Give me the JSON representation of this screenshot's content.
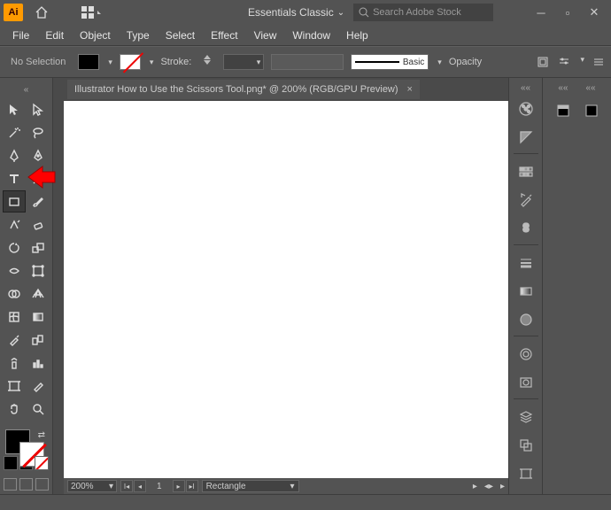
{
  "titlebar": {
    "app_abbrev": "Ai",
    "workspace_label": "Essentials Classic",
    "search_placeholder": "Search Adobe Stock"
  },
  "menubar": {
    "items": [
      "File",
      "Edit",
      "Object",
      "Type",
      "Select",
      "Effect",
      "View",
      "Window",
      "Help"
    ]
  },
  "controlbar": {
    "selection_status": "No Selection",
    "stroke_label": "Stroke:",
    "brush_label": "Basic",
    "opacity_label": "Opacity"
  },
  "document": {
    "tab_title": "Illustrator How to Use the Scissors Tool.png* @ 200% (RGB/GPU Preview)"
  },
  "status": {
    "zoom": "200%",
    "artboard_current": "1",
    "artboard_tool": "Rectangle"
  },
  "icons": {
    "home": "home-icon",
    "arrange": "arrange-docs-icon",
    "search": "search-icon",
    "min": "minimize-icon",
    "restore": "restore-icon",
    "close": "close-icon"
  }
}
